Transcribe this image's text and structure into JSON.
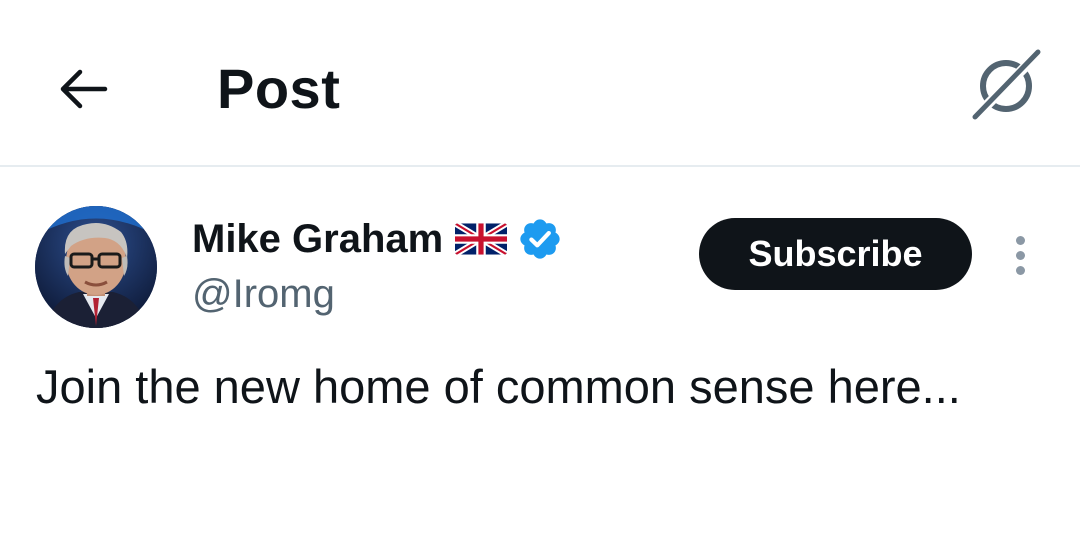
{
  "header": {
    "title": "Post",
    "back_icon": "arrow-left-icon",
    "grok_icon": "grok-icon"
  },
  "post": {
    "author": {
      "name": "Mike Graham",
      "flag_icon": "uk-flag-icon",
      "verified_icon": "verified-badge-icon",
      "handle": "@Iromg"
    },
    "subscribe_label": "Subscribe",
    "more_icon": "more-vertical-icon",
    "text": "Join the new home of common sense here..."
  },
  "colors": {
    "text": "#0f1419",
    "secondary": "#536471",
    "verified": "#1d9bf0",
    "divider": "#e6ecf0"
  }
}
